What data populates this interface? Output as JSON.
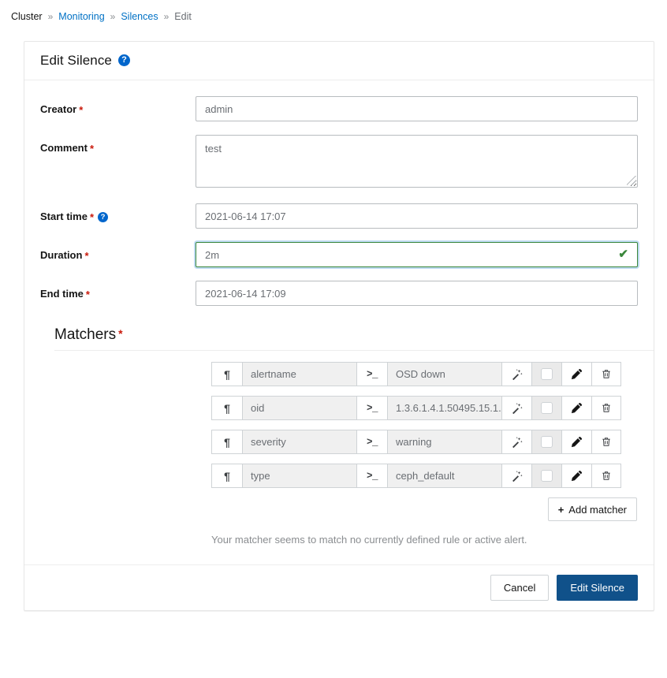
{
  "breadcrumb": {
    "separator": "»",
    "items": [
      {
        "label": "Cluster",
        "type": "text"
      },
      {
        "label": "Monitoring",
        "type": "link"
      },
      {
        "label": "Silences",
        "type": "link"
      },
      {
        "label": "Edit",
        "type": "current"
      }
    ]
  },
  "card": {
    "title": "Edit Silence",
    "help_icon": "?",
    "help_icon_name": "question-circle-icon"
  },
  "form": {
    "required_mark": "*",
    "creator": {
      "label": "Creator",
      "value": "admin"
    },
    "comment": {
      "label": "Comment",
      "value": "test"
    },
    "start_time": {
      "label": "Start time",
      "value": "2021-06-14 17:07",
      "help_icon": "?"
    },
    "duration": {
      "label": "Duration",
      "value": "2m",
      "valid": true,
      "valid_check": "✔"
    },
    "end_time": {
      "label": "End time",
      "value": "2021-06-14 17:09"
    }
  },
  "matchers": {
    "title": "Matchers",
    "required_mark": "*",
    "name_addon_icon": "pilcrow-icon",
    "name_addon_glyph": "¶",
    "value_addon_icon": "terminal-prompt-icon",
    "value_addon_glyph": ">_",
    "rows": [
      {
        "name": "alertname",
        "value": "OSD down"
      },
      {
        "name": "oid",
        "value": "1.3.6.1.4.1.50495.15.1.  ..."
      },
      {
        "name": "severity",
        "value": "warning"
      },
      {
        "name": "type",
        "value": "ceph_default"
      }
    ],
    "row_actions": {
      "wand_icon": "magic-wand-icon",
      "checkbox_icon": "checkbox-icon",
      "edit_icon": "pencil-icon",
      "delete_icon": "trash-icon"
    },
    "add_button": {
      "label": "Add matcher",
      "plus": "+"
    },
    "hint": "Your matcher seems to match no currently defined rule or active alert."
  },
  "footer": {
    "cancel_label": "Cancel",
    "submit_label": "Edit Silence"
  },
  "colors": {
    "link": "#0071c5",
    "primary_button": "#10518a",
    "required": "#c9190b",
    "valid_border": "#3a873b",
    "help_icon": "#0066cc"
  }
}
